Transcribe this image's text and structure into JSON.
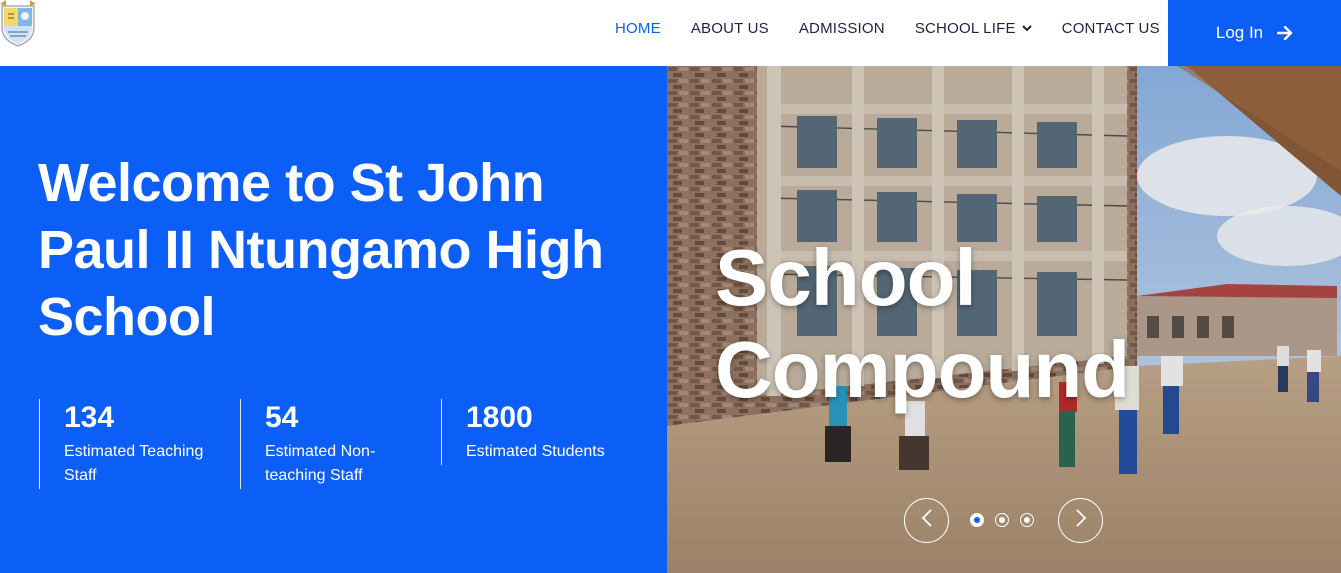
{
  "header": {
    "nav": [
      {
        "label": "HOME",
        "active": true
      },
      {
        "label": "ABOUT US"
      },
      {
        "label": "ADMISSION"
      },
      {
        "label": "SCHOOL LIFE",
        "has_dropdown": true
      },
      {
        "label": "CONTACT US"
      }
    ],
    "login_label": "Log In"
  },
  "hero": {
    "title": "Welcome to St John Paul II Ntungamo High School",
    "stats": [
      {
        "value": "134",
        "label": "Estimated Teaching Staff"
      },
      {
        "value": "54",
        "label": "Estimated Non-teaching Staff"
      },
      {
        "value": "1800",
        "label": "Estimated Students"
      }
    ]
  },
  "slider": {
    "caption": "School Compound",
    "slides_count": 3,
    "active_slide": 1
  },
  "colors": {
    "brand_blue": "#0b5ff7",
    "nav_text": "#1c2340",
    "nav_active": "#0a63e8"
  },
  "icons": {
    "logo": "school-crest-logo",
    "chevron": "chevron-down-icon",
    "login_arrow": "arrow-right-icon",
    "prev": "chevron-left-icon",
    "next": "chevron-right-icon"
  }
}
